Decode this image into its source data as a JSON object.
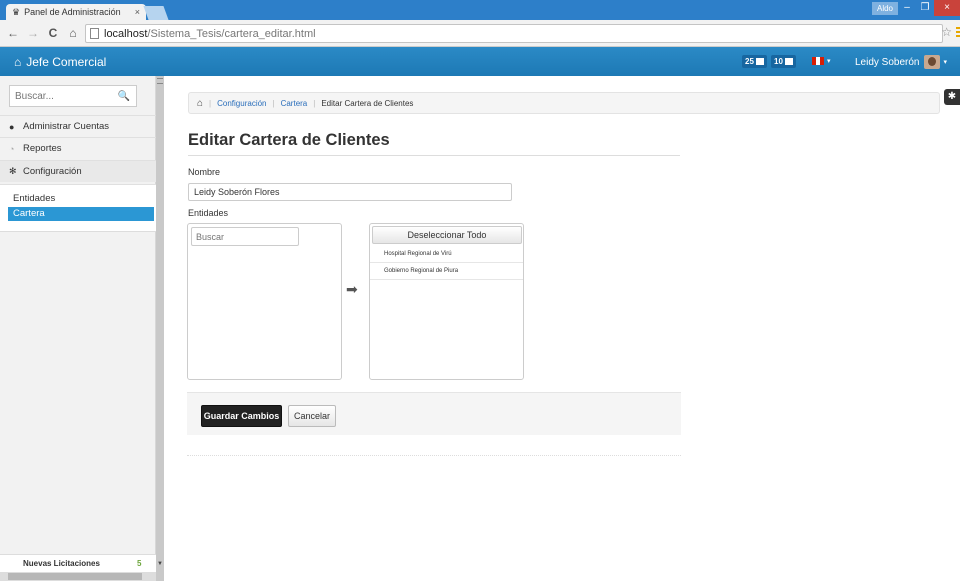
{
  "browser": {
    "tab_title": "Panel de Administración",
    "tab_close": "×",
    "window_user": "Aldo",
    "window_minimize": "–",
    "window_restore": "❐",
    "window_close": "×",
    "url_host": "localhost",
    "url_path": "/Sistema_Tesis/cartera_editar.html",
    "back": "←",
    "forward": "→",
    "reload": "C",
    "home": "⌂",
    "bookmark": "☆"
  },
  "navbar": {
    "brand": "Jefe Comercial",
    "badge_messages": "25",
    "badge_calendar": "10",
    "language_caret": "▾",
    "user_name": "Leidy Soberón",
    "user_caret": "▾"
  },
  "sidebar": {
    "search_placeholder": "Buscar...",
    "items": [
      {
        "label": "Administrar Cuentas",
        "icon": "user-icon"
      },
      {
        "label": "Reportes",
        "icon": "chart-icon"
      },
      {
        "label": "Configuración",
        "icon": "gear-icon"
      }
    ],
    "sub_items": [
      {
        "label": "Entidades",
        "selected": false
      },
      {
        "label": "Cartera",
        "selected": true
      }
    ],
    "footer_label": "Nuevas Licitaciones",
    "footer_count": "5"
  },
  "breadcrumb": {
    "items": [
      "Configuración",
      "Cartera",
      "Editar Cartera de Clientes"
    ]
  },
  "main": {
    "title": "Editar Cartera de Clientes",
    "name_label": "Nombre",
    "name_value": "Leidy Soberón Flores",
    "entities_label": "Entidades",
    "filter_placeholder": "Buscar",
    "deselect_all": "Deseleccionar Todo",
    "selected_entities": [
      "Hospital Regional de Virú",
      "Gobierno Regional de Piura"
    ],
    "move_arrow": "➡",
    "save_label": "Guardar Cambios",
    "cancel_label": "Cancelar"
  },
  "colors": {
    "navbar": "#1d79b5",
    "selected_item": "#2b97d4",
    "primary_button": "#222222",
    "badge_count": "#6ca53b"
  }
}
